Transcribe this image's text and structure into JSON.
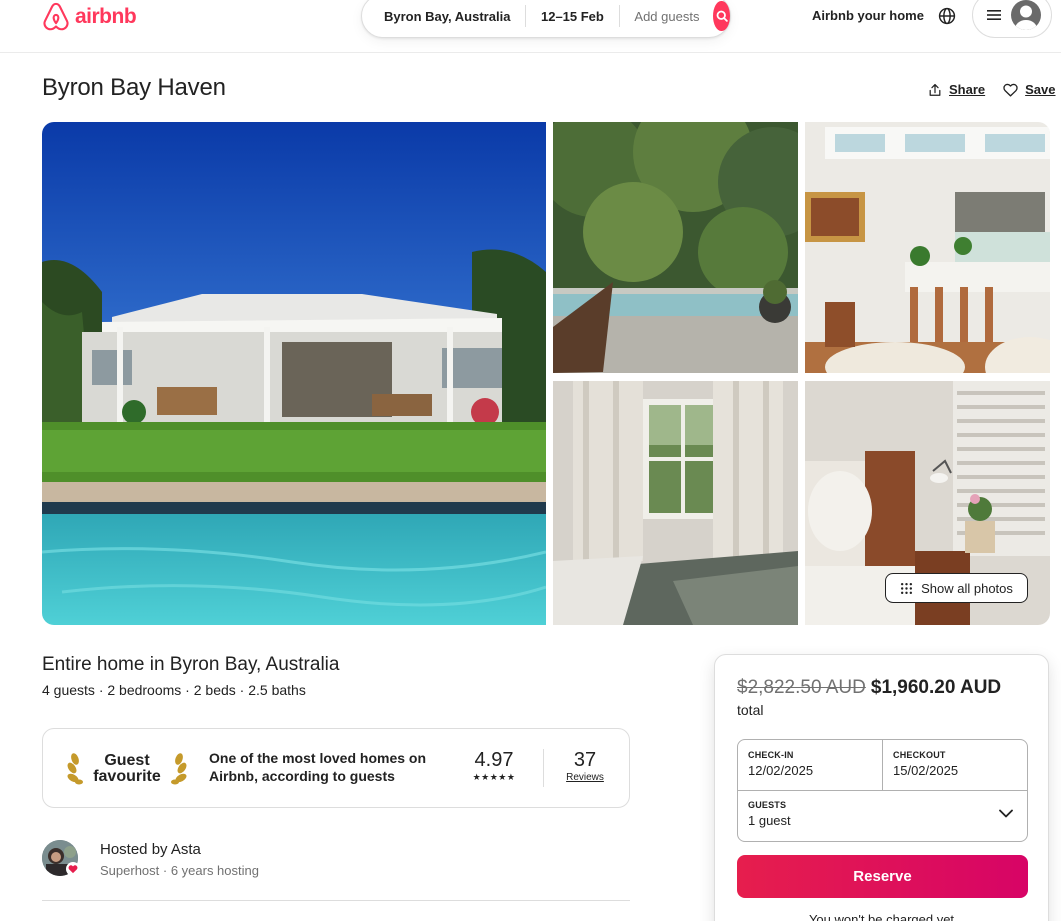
{
  "brand": {
    "name": "airbnb",
    "color": "#ff385c"
  },
  "search": {
    "location": "Byron Bay, Australia",
    "dates": "12–15 Feb",
    "guests_placeholder": "Add guests"
  },
  "header": {
    "host_link": "Airbnb your home",
    "globe_icon": "globe-icon",
    "menu_icon": "hamburger-menu-icon",
    "avatar_icon": "user-avatar-icon"
  },
  "listing": {
    "title": "Byron Bay Haven",
    "share_label": "Share",
    "save_label": "Save",
    "type": "Entire home in Byron Bay, Australia",
    "specs": "4 guests · 2 bedrooms · 2 beds · 2.5 baths",
    "show_all_photos": "Show all photos"
  },
  "guest_favourite": {
    "badge_line1": "Guest",
    "badge_line2": "favourite",
    "description": "One of the most loved homes on Airbnb, according to guests",
    "rating": "4.97",
    "stars": "★★★★★",
    "reviews_count": "37",
    "reviews_label": "Reviews"
  },
  "host": {
    "name": "Hosted by Asta",
    "subtitle": "Superhost · 6 years hosting"
  },
  "booking": {
    "price_original": "$2,822.50 AUD",
    "price_discounted": "$1,960.20 AUD",
    "price_suffix": "total",
    "checkin_label": "CHECK-IN",
    "checkin_value": "12/02/2025",
    "checkout_label": "CHECKOUT",
    "checkout_value": "15/02/2025",
    "guests_label": "GUESTS",
    "guests_value": "1 guest",
    "reserve_label": "Reserve",
    "no_charge_note": "You won't be charged yet",
    "reserve_color": "#e61e4d"
  }
}
